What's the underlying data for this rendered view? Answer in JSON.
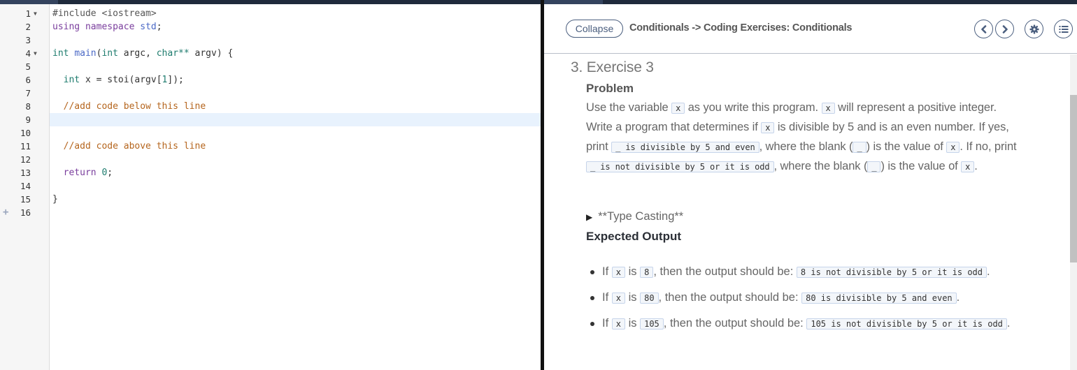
{
  "editor": {
    "lines": [
      {
        "n": "1",
        "fold": true
      },
      {
        "n": "2"
      },
      {
        "n": "3"
      },
      {
        "n": "4",
        "fold": true
      },
      {
        "n": "5"
      },
      {
        "n": "6"
      },
      {
        "n": "7"
      },
      {
        "n": "8"
      },
      {
        "n": "9"
      },
      {
        "n": "10"
      },
      {
        "n": "11"
      },
      {
        "n": "12"
      },
      {
        "n": "13"
      },
      {
        "n": "14"
      },
      {
        "n": "15"
      },
      {
        "n": "16",
        "add": true
      }
    ],
    "code": {
      "l1_pp": "#include <iostream>",
      "l2_using": "using",
      "l2_namespace": "namespace",
      "l2_std": "std",
      "l2_semi": ";",
      "l4_int": "int",
      "l4_main": "main",
      "l4_open": "(",
      "l4_int2": "int",
      "l4_argc": " argc, ",
      "l4_char": "char**",
      "l4_rest": " argv) {",
      "l6_indent": "  ",
      "l6_int": "int",
      "l6_mid": " x = stoi(argv[",
      "l6_one": "1",
      "l6_end": "]);",
      "l8_comment": "  //add code below this line",
      "l11_comment": "  //add code above this line",
      "l13_indent": "  ",
      "l13_return": "return",
      "l13_sp": " ",
      "l13_zero": "0",
      "l13_semi": ";",
      "l15_brace": "}"
    },
    "active_line": 9
  },
  "guide": {
    "collapse_label": "Collapse",
    "breadcrumb": "Conditionals -> Coding Exercises: Conditionals",
    "icons": [
      "chevron-left-icon",
      "chevron-right-icon",
      "gear-icon",
      "list-icon"
    ],
    "exercise_title": "3. Exercise 3",
    "problem_heading": "Problem",
    "problem": {
      "t1": "Use the variable ",
      "c1": "x",
      "t2": " as you write this program. ",
      "c2": "x",
      "t3": " will represent a positive integer. Write a program that determines if ",
      "c3": "x",
      "t4": " is divisible by 5 and is an even number. If yes, print ",
      "c4": "_ is divisible by 5 and even",
      "t5": ", where the blank (",
      "c5": "_",
      "t6": ") is the value of ",
      "c6": "x",
      "t7": ". If no, print ",
      "c7": "_ is not divisible by 5 or it is odd",
      "t8": ", where the blank (",
      "c8": "_",
      "t9": ") is the value of ",
      "c9": "x",
      "t10": "."
    },
    "details_label": "**Type Casting**",
    "expected_heading": "Expected Output",
    "examples": [
      {
        "if": "If ",
        "var": "x",
        "is": " is ",
        "val": "8",
        "then": ", then the output should be: ",
        "out": "8 is not divisible by 5 or it is odd",
        "end": "."
      },
      {
        "if": "If ",
        "var": "x",
        "is": " is ",
        "val": "80",
        "then": ", then the output should be: ",
        "out": "80 is divisible by 5 and even",
        "end": "."
      },
      {
        "if": "If ",
        "var": "x",
        "is": " is ",
        "val": "105",
        "then": ", then the output should be: ",
        "out": "105 is not divisible by 5 or it is odd",
        "end": "."
      }
    ]
  },
  "colors": {
    "tabbar": "#1f2a3c",
    "active_tab": "#34435e",
    "active_line_bg": "#e8f2fd",
    "keyword": "#7a3e9d",
    "type": "#1e7c6e",
    "comment": "#b5651d",
    "button_border": "#4a5e7e"
  }
}
